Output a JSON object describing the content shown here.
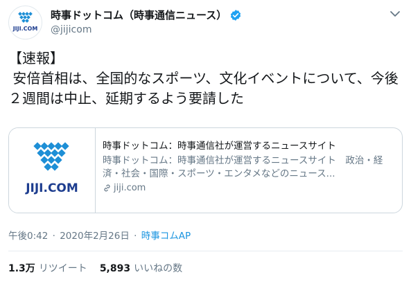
{
  "account": {
    "display_name": "時事ドットコム（時事通信ニュース）",
    "handle": "@jijicom",
    "avatar_text": "JIJI.COM"
  },
  "tweet": {
    "text": "【速報】\n 安倍首相は、全国的なスポーツ、文化イベントについて、今後２週間は中止、延期するよう要請した"
  },
  "card": {
    "logo_text": "JIJI.COM",
    "title": "時事ドットコム：時事通信社が運営するニュースサイト",
    "description": "時事ドットコム：時事通信社が運営するニュースサイト　政治・経済・社会・国際・スポーツ・エンタメなどのニュース...",
    "domain": "jiji.com"
  },
  "meta": {
    "time": "午後0:42",
    "separator": "·",
    "date": "2020年2月26日",
    "source": "時事コムAP"
  },
  "stats": {
    "retweets_count": "1.3万",
    "retweets_label": "リツイート",
    "likes_count": "5,893",
    "likes_label": "いいねの数"
  },
  "colors": {
    "link": "#1b95e0",
    "verified": "#1da1f2",
    "logo_blue": "#1e8fd6",
    "logo_text": "#1d3d8f"
  },
  "icons": {
    "verified": "verified-badge-icon",
    "menu": "chevron-down-icon",
    "link": "link-icon"
  }
}
